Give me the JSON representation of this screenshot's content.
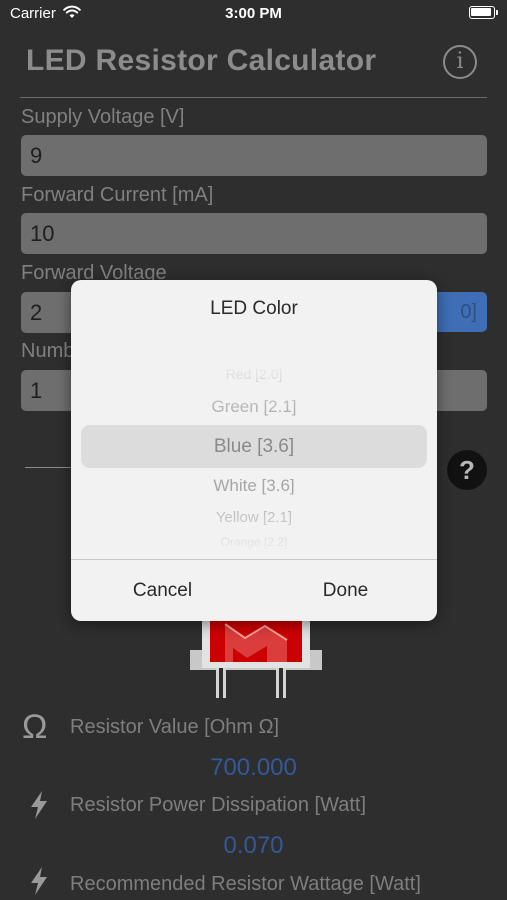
{
  "status_bar": {
    "carrier": "Carrier",
    "time": "3:00 PM"
  },
  "header": {
    "title": "LED Resistor Calculator",
    "info_icon": "i"
  },
  "form": {
    "supply_voltage": {
      "label": "Supply Voltage [V]",
      "value": "9"
    },
    "forward_current": {
      "label": "Forward Current [mA]",
      "value": "10"
    },
    "forward_voltage": {
      "label": "Forward Voltage",
      "value": "2",
      "led_select_value": "0]"
    },
    "number_of_leds": {
      "label": "Numb",
      "value": "1"
    }
  },
  "help_icon": "?",
  "results": {
    "resistor_value": {
      "icon": "Ω",
      "label": "Resistor Value [Ohm Ω]",
      "value": "700.000"
    },
    "power_dissipation": {
      "label": "Resistor Power Dissipation [Watt]",
      "value": "0.070"
    },
    "recommended_wattage": {
      "label": "Recommended Resistor Wattage [Watt]"
    }
  },
  "modal": {
    "title": "LED Color",
    "options": [
      "Red [2.0]",
      "Green [2.1]",
      "Blue [3.6]",
      "White [3.6]",
      "Yellow [2.1]",
      "Orange [2.2]"
    ],
    "selected": "Blue [3.6]",
    "cancel_label": "Cancel",
    "done_label": "Done"
  },
  "colors": {
    "accent_blue": "#33599a",
    "led_red": "#cc0000",
    "background": "#2e2e2e"
  }
}
